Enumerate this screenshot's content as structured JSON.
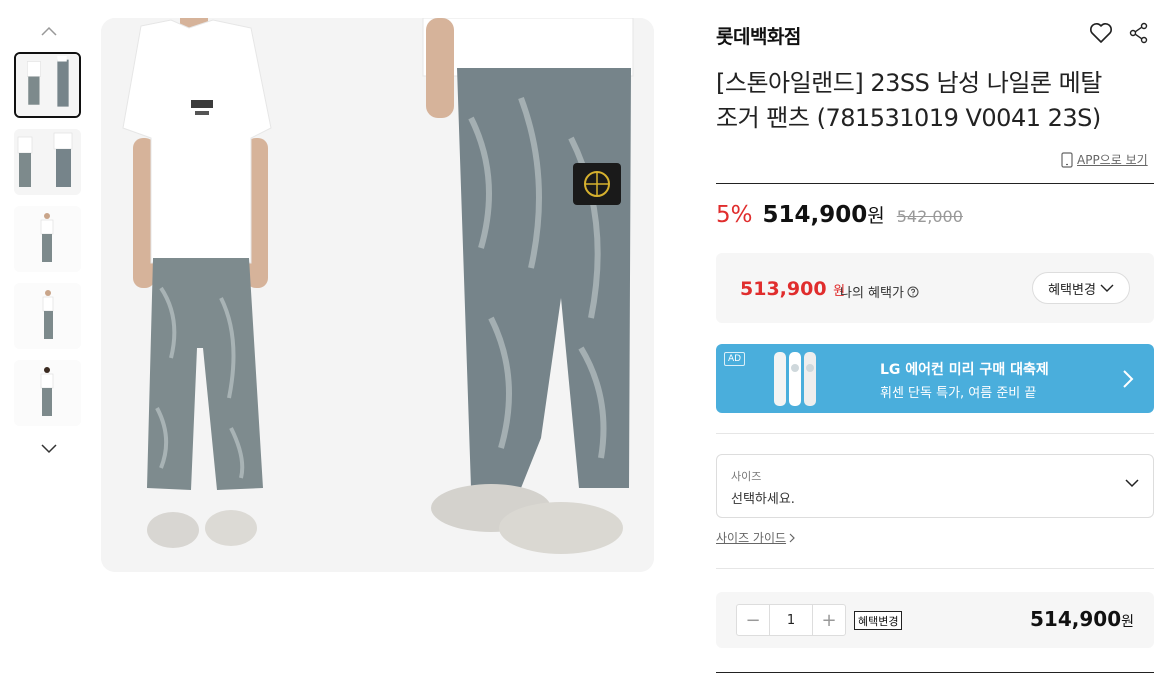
{
  "gallery": {
    "thumbnails": [
      {
        "alt": "thumbnail 1"
      },
      {
        "alt": "thumbnail 2"
      },
      {
        "alt": "thumbnail 3"
      },
      {
        "alt": "thumbnail 4"
      },
      {
        "alt": "thumbnail 5"
      }
    ],
    "active_index": 0,
    "up_icon": "chevron-up-icon",
    "down_icon": "chevron-down-icon"
  },
  "product": {
    "brand": "롯데백화점",
    "title_line1": "[스톤아일랜드] 23SS 남성 나일론 메탈",
    "title_line2": "조거 팬츠 (781531019 V0041 23S)",
    "app_link": "APP으로 보기",
    "discount": "5%",
    "price": "514,900",
    "price_unit": "원",
    "original_price": "542,000"
  },
  "benefit": {
    "price": "513,900",
    "unit": "원",
    "label": "나의 혜택가",
    "change_button": "혜택변경"
  },
  "ad": {
    "tag": "AD",
    "title": "LG 에어컨 미리 구매 대축제",
    "subtitle": "휘센 단독 특가, 여름 준비 끝"
  },
  "size": {
    "label": "사이즈",
    "placeholder": "선택하세요.",
    "guide": "사이즈 가이드"
  },
  "order": {
    "quantity": "1",
    "minus": "−",
    "plus": "+",
    "badge": "혜택변경",
    "total": "514,900",
    "unit": "원"
  },
  "colors": {
    "discount_red": "#e02d2d",
    "ad_blue": "#4aaedc"
  }
}
